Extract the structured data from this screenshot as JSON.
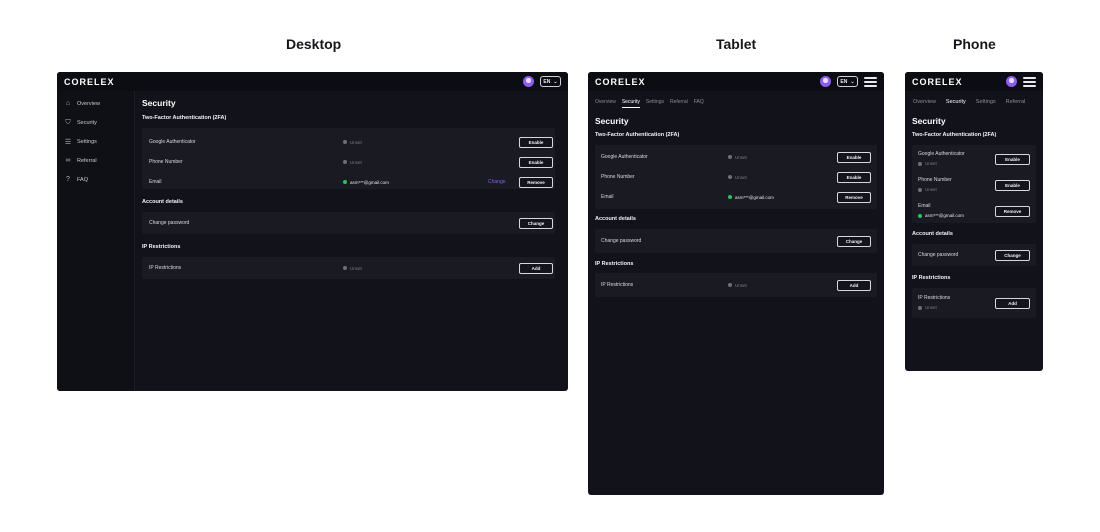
{
  "labels": {
    "desktop": "Desktop",
    "tablet": "Tablet",
    "phone": "Phone"
  },
  "app": {
    "logo": "CORELEX",
    "lang": "EN"
  },
  "nav": [
    "Overview",
    "Security",
    "Settings",
    "Referral",
    "FAQ"
  ],
  "nav_icons": [
    "house-icon",
    "shield-icon",
    "sliders-icon",
    "link-icon",
    "help-chat-icon"
  ],
  "page": {
    "title": "Security"
  },
  "twofa": {
    "title": "Two-Factor Authentication (2FA)",
    "rows": [
      {
        "label": "Google Authenticator",
        "status": "Unset",
        "action": "Enable"
      },
      {
        "label": "Phone Number",
        "status": "Unset",
        "action": "Enable"
      },
      {
        "label": "Email",
        "status": "asm***@gmail.com",
        "action": "Remove",
        "link": "Change"
      }
    ]
  },
  "account": {
    "title": "Account details",
    "label": "Change password",
    "action": "Change"
  },
  "ip": {
    "title": "IP Restrictions",
    "label": "IP Restrictions",
    "status": "Unset",
    "action": "Add"
  },
  "colors": {
    "accent": "#8b5cf6",
    "success": "#22c55e",
    "background": "#12131a"
  }
}
